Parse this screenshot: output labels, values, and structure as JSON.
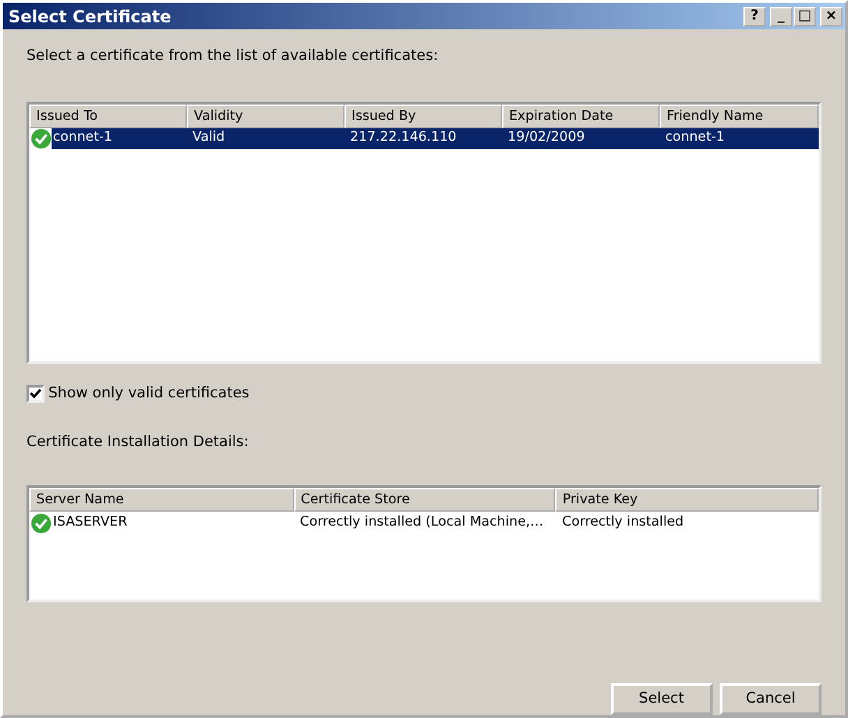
{
  "window": {
    "title": "Select Certificate",
    "controls": [
      "?",
      "_",
      "□",
      "×"
    ]
  },
  "instruction": "Select a certificate from the list of available certificates:",
  "certificates": {
    "columns": [
      "Issued To",
      "Validity",
      "Issued By",
      "Expiration Date",
      "Friendly Name"
    ],
    "rows": [
      {
        "cells": [
          "connet-1",
          "Valid",
          "217.22.146.110",
          "19/02/2009",
          "connet-1"
        ],
        "selected": true
      }
    ]
  },
  "valid_only": {
    "label": "Show only valid certificates",
    "checked": true
  },
  "details_label": "Certificate Installation Details:",
  "details": {
    "columns": [
      "Server Name",
      "Certificate Store",
      "Private Key"
    ],
    "rows": [
      {
        "cells": [
          "ISASERVER",
          "Correctly installed (Local Machine,…",
          "Correctly installed"
        ],
        "selected": false
      }
    ]
  },
  "buttons": [
    "Select",
    "Cancel"
  ]
}
